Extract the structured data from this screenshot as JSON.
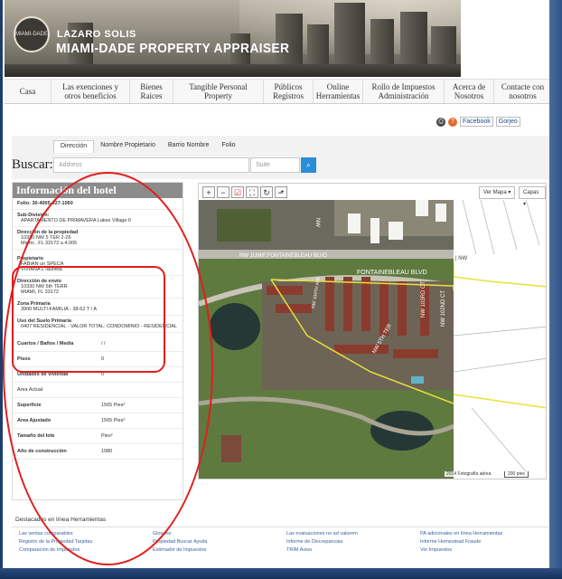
{
  "brand": {
    "top": "LAZARO SOLIS",
    "main": "MIAMI-DADE PROPERTY APPRAISER",
    "seal": "MIAMI-DADE"
  },
  "nav": [
    {
      "label": "Casa"
    },
    {
      "label": "Las exenciones y otros beneficios"
    },
    {
      "label": "Bienes Raices"
    },
    {
      "label": "Tangible Personal Property"
    },
    {
      "label": "Públicos Registros"
    },
    {
      "label": "Online Herramientas"
    },
    {
      "label": "Rollo de Impuestos Administración"
    },
    {
      "label": "Acerca de Nosotros"
    },
    {
      "label": "Contacte con nosotros"
    }
  ],
  "tools": {
    "facebook": "Facebook",
    "gorjeo": "Gorjeo"
  },
  "search": {
    "tabs": [
      "Dirección",
      "Nombre Propietario",
      "Barrio Nombre",
      "Folio"
    ],
    "label": "Buscar:",
    "address_placeholder": "Address",
    "suite_placeholder": "Suite"
  },
  "info": {
    "header": "Información del hotel",
    "folio": "Folio: 30-4005-027-1060",
    "subdivision": {
      "label": "Sub-División:",
      "value": "APARTAMENTO DE PRIMAVERA Lakes Village II"
    },
    "property_address": {
      "label": "Dirección de la propiedad",
      "lines": [
        "10330 NW 5 TER 2-26",
        "Miami , FL 33172 a 4.005"
      ]
    },
    "owner": {
      "label": "Propietario",
      "lines": [
        "FABIAN un SPECA",
        "VIVIANA L Iaurleta"
      ]
    },
    "mailing": {
      "label": "Dirección de envío",
      "lines": [
        "10330 NW 5th TERR",
        "MIAMI, FL 33172"
      ]
    },
    "zone": {
      "label": "Zona Primaria",
      "value": "3900 MULTI-FAMILIA - 38-62 T / A"
    },
    "land_use": {
      "label": "Uso del Suelo Primaria",
      "value": "0407 RESIDENCIAL - VALOR TOTAL: CONDOMINIO - RESIDENCIAL"
    },
    "rows": [
      {
        "k": "Cuartos / Baños / Media",
        "v": "/ /"
      },
      {
        "k": "Pisos",
        "v": "0"
      },
      {
        "k": "Unidades de vivienda",
        "v": "0"
      },
      {
        "k": "Area Actual",
        "v": ""
      },
      {
        "k": "Superficie",
        "v": "1565 Pies²"
      },
      {
        "k": "Area Ajustado",
        "v": "1565 Pies²"
      },
      {
        "k": "Tamaño del lote",
        "v": "Pies²"
      },
      {
        "k": "Año de construcción",
        "v": "1980"
      }
    ]
  },
  "map": {
    "controls": [
      "+",
      "−",
      "☑",
      "⛶",
      "↻",
      "⬏"
    ],
    "map_type": "Ver Mapa ▾",
    "layers": "Capas ▾",
    "street_main": "FONTAINEBLEAU BLVD",
    "street_main_left": "NW 1UMIF.FONTAINEBLEAU BLVD",
    "street_nw": "NW",
    "street_5th": "NW 5TH TER",
    "street_103": "NW 103RD CT",
    "street_102": "NW 102ND CT",
    "street_104": "NW 104TH AVE",
    "credit": "2014 Fotografía aérea",
    "scale": "200 pies"
  },
  "footer": {
    "title": "Destacados en línea Herramientas",
    "links": [
      "Las ventas comparables",
      "Glosario",
      "Las evaluaciones no ad valorem",
      "PA adicionales en línea Herramientas",
      "Registro de la Propiedad Tarjetas",
      "Propiedad Buscar Ayuda",
      "Informe de Discrepancias",
      "Informe Homestead Fraude",
      "Comparación de Impuestos",
      "Estimador de Impuestos",
      "TRIM Aviso",
      "Ver Impuestos"
    ]
  },
  "colors": {
    "accent": "#2a8ed8",
    "annotation": "#e21d1d",
    "link": "#3a62a0"
  }
}
